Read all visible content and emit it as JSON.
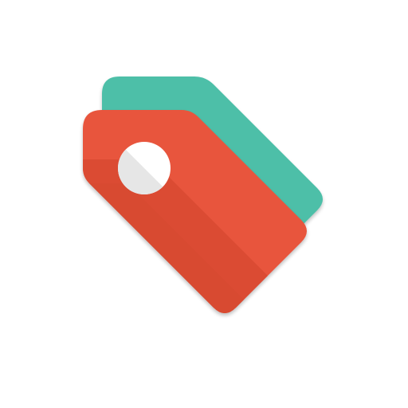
{
  "icon": {
    "name": "price-tags-app-icon",
    "colors": {
      "back_tag": "#4DBFA8",
      "front_tag_light": "#E8553C",
      "front_tag_dark": "#D84A31",
      "hole_light": "#FFFFFF",
      "hole_dark": "#E6E6E6",
      "background": "#FFFFFF"
    }
  }
}
